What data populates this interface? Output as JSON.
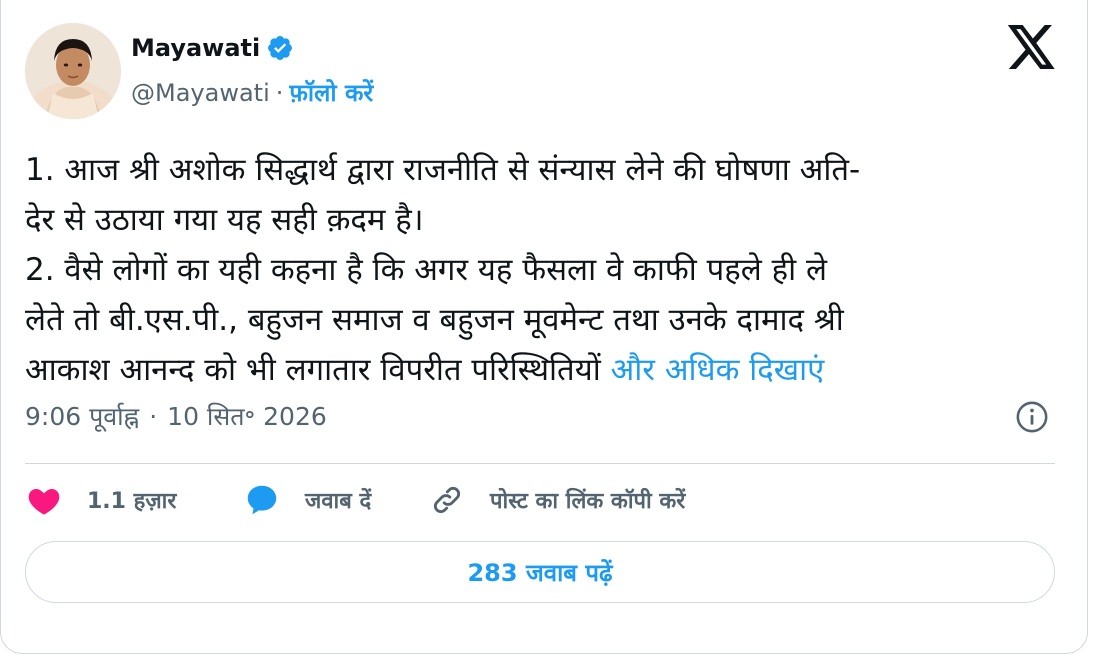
{
  "author": {
    "name": "Mayawati",
    "handle": "@Mayawati",
    "follow_label": "फ़ॉलो करें"
  },
  "tweet": {
    "line1": "1. आज श्री अशोक सिद्धार्थ द्वारा राजनीति से संन्यास लेने की घोषणा अति-",
    "line2": "देर से उठाया गया यह सही क़दम है।",
    "line3": "2. वैसे लोगों का यही कहना है कि अगर यह फैसला वे काफी पहले ही ले",
    "line4": "लेते तो बी.एस.पी., बहुजन समाज व बहुजन मूवमेन्ट तथा उनके दामाद श्री",
    "line5": "आकाश आनन्द को भी लगातार विपरीत परिस्थितियों ",
    "show_more": "और अधिक दिखाएं"
  },
  "meta": {
    "time": "9:06 पूर्वाह्न",
    "date": "10 सित॰ 2026"
  },
  "actions": {
    "likes": "1.1 हज़ार",
    "reply": "जवाब दें",
    "copy_link": "पोस्ट का लिंक कॉपी करें"
  },
  "read_replies": "283 जवाब पढ़ें",
  "colors": {
    "accent": "#1d9bf0",
    "like": "#f91880",
    "muted": "#536471",
    "text": "#0f1419",
    "border": "#cfd9de"
  },
  "icons": [
    "verified-badge-icon",
    "x-logo-icon",
    "info-icon",
    "heart-icon",
    "reply-bubble-icon",
    "link-icon"
  ]
}
